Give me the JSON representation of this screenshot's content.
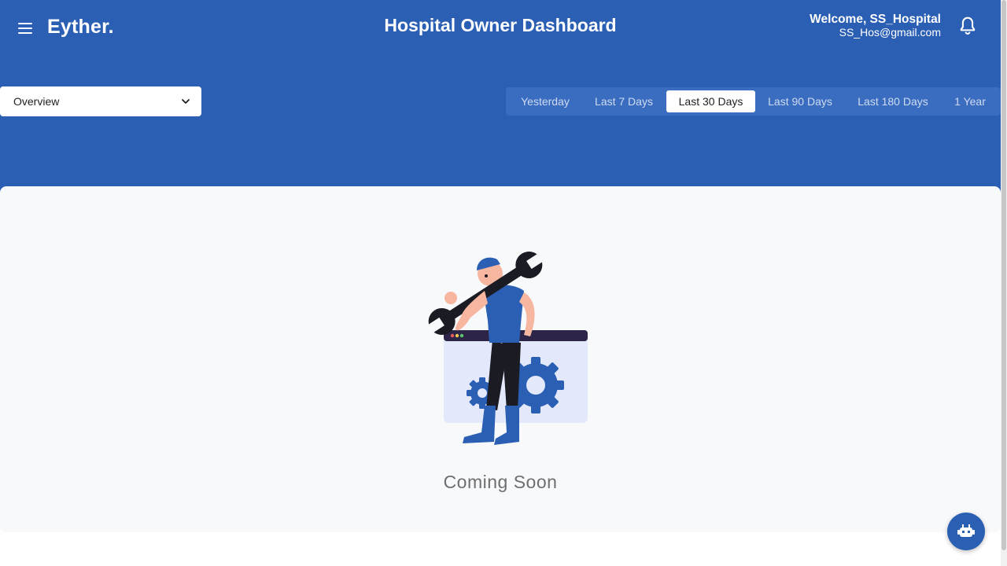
{
  "header": {
    "logo": "Eyther.",
    "title": "Hospital Owner Dashboard",
    "welcome": "Welcome, SS_Hospital",
    "email": "SS_Hos@gmail.com",
    "icons": [
      "menu-icon",
      "bell-icon"
    ]
  },
  "view_select": {
    "value": "Overview",
    "icon": "chevron-down-icon"
  },
  "date_ranges": {
    "selected": "Last 30 Days",
    "items": [
      "Yesterday",
      "Last 7 Days",
      "Last 30 Days",
      "Last 90 Days",
      "Last 180 Days",
      "1 Year"
    ]
  },
  "main": {
    "message": "Coming Soon",
    "illustration": "mechanic-with-wrench-illustration"
  },
  "fab": {
    "icon": "chat-bot-icon"
  },
  "colors": {
    "brand": "#2b5fb4",
    "panel_bg": "#f8f9fb",
    "accent_text": "#6e6e6e"
  }
}
